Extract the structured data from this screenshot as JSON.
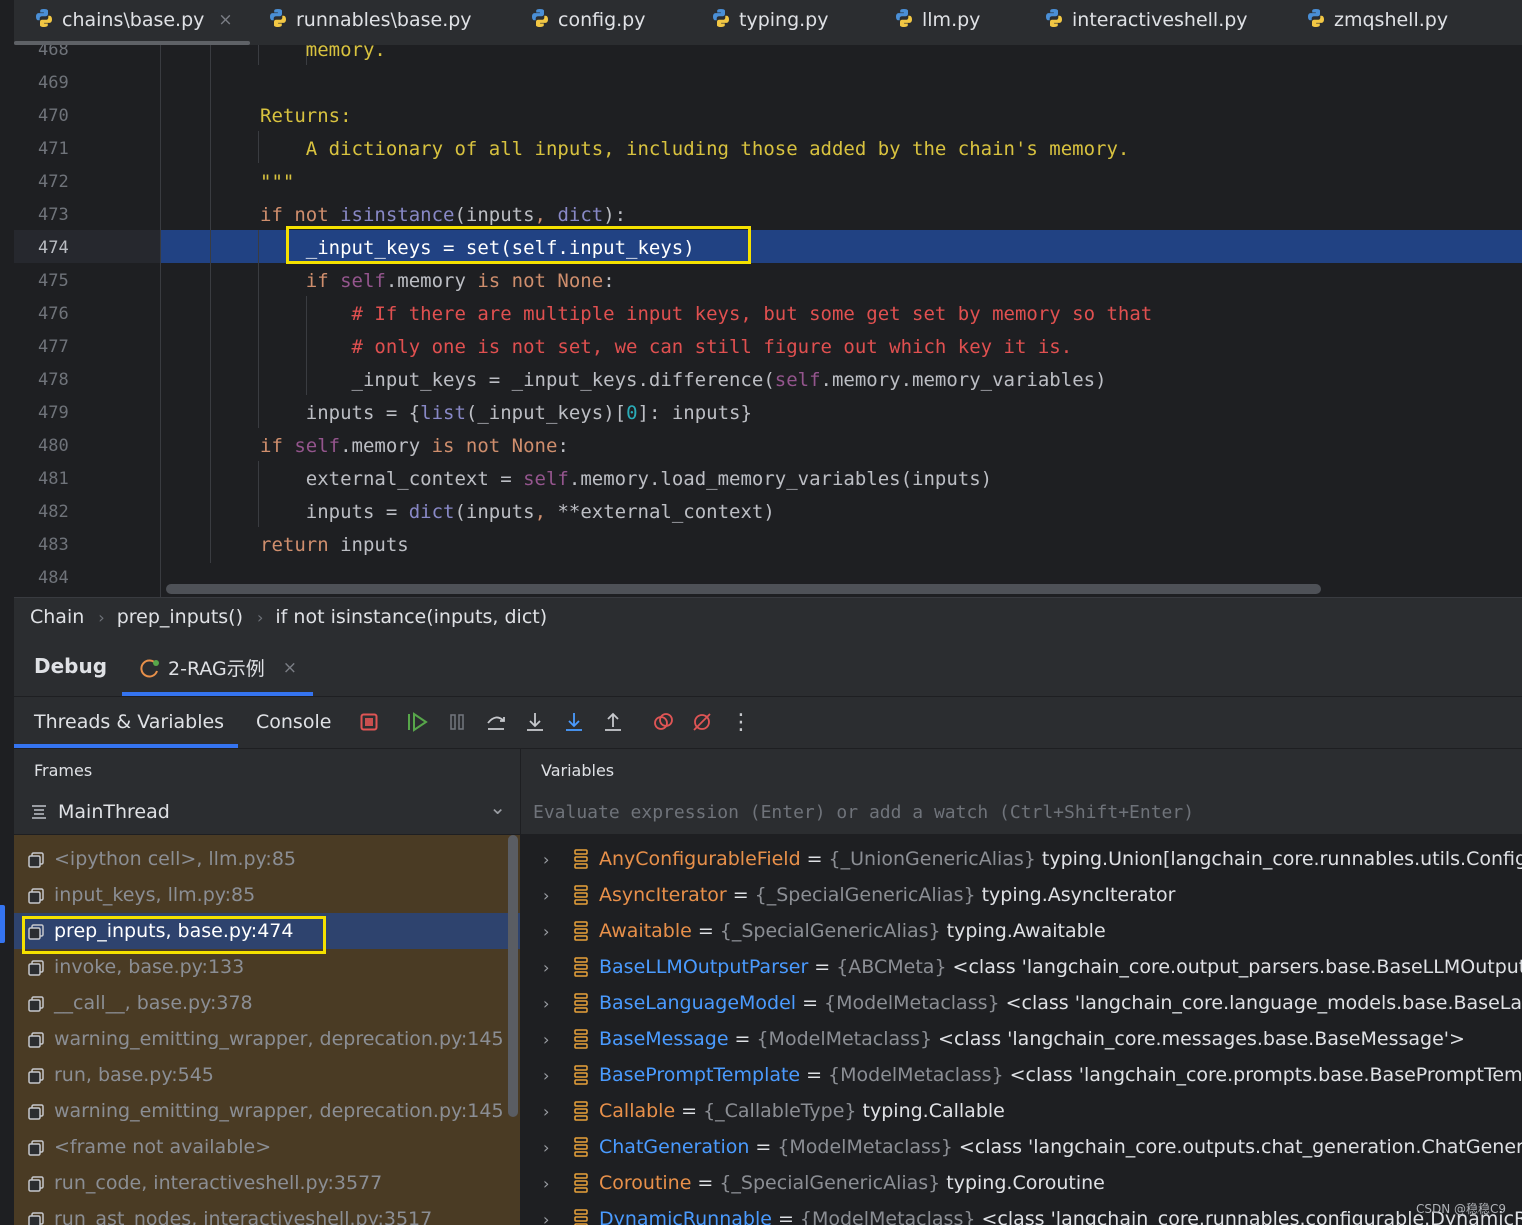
{
  "tabs": [
    {
      "label": "chains\\base.py",
      "active": true
    },
    {
      "label": "runnables\\base.py"
    },
    {
      "label": "config.py"
    },
    {
      "label": "typing.py"
    },
    {
      "label": "llm.py"
    },
    {
      "label": "interactiveshell.py"
    },
    {
      "label": "zmqshell.py"
    }
  ],
  "tab_close_glyph": "×",
  "editor": {
    "line_numbers": [
      "468",
      "469",
      "470",
      "471",
      "472",
      "473",
      "474",
      "475",
      "476",
      "477",
      "478",
      "479",
      "480",
      "481",
      "482",
      "483",
      "484"
    ],
    "current_line": "474",
    "lines": [
      {
        "text": "    memory."
      },
      {
        "text": ""
      },
      {
        "text": "Returns:"
      },
      {
        "text": "    A dictionary of all inputs, including those added by the chain's memory."
      },
      {
        "text": "\"\"\""
      },
      {
        "text": "if not isinstance(inputs, dict):"
      },
      {
        "text": "    _input_keys = set(self.input_keys)"
      },
      {
        "text": "    if self.memory is not None:"
      },
      {
        "text": "        # If there are multiple input keys, but some get set by memory so that"
      },
      {
        "text": "        # only one is not set, we can still figure out which key it is."
      },
      {
        "text": "        _input_keys = _input_keys.difference(self.memory.memory_variables)"
      },
      {
        "text": "    inputs = {list(_input_keys)[0]: inputs}"
      },
      {
        "text": "if self.memory is not None:"
      },
      {
        "text": "    external_context = self.memory.load_memory_variables(inputs)"
      },
      {
        "text": "    inputs = dict(inputs, **external_context)"
      },
      {
        "text": "return inputs"
      },
      {
        "text": ""
      }
    ]
  },
  "breadcrumb": [
    "Chain",
    "prep_inputs()",
    "if not isinstance(inputs, dict)"
  ],
  "breadcrumb_sep": "›",
  "debug": {
    "title": "Debug",
    "run_tab": "2-RAG示例",
    "close_glyph": "×",
    "tabs": [
      "Threads & Variables",
      "Console"
    ],
    "more_glyph": "⋮",
    "frames_header": "Frames",
    "variables_header": "Variables",
    "thread": "MainThread",
    "thread_chevron": "⌄",
    "eval_placeholder": "Evaluate expression (Enter) or add a watch (Ctrl+Shift+Enter)",
    "frames": [
      "<ipython cell>, llm.py:85",
      "input_keys, llm.py:85",
      "prep_inputs, base.py:474",
      "invoke, base.py:133",
      "__call__, base.py:378",
      "warning_emitting_wrapper, deprecation.py:145",
      "run, base.py:545",
      "warning_emitting_wrapper, deprecation.py:145",
      "<frame not available>",
      "run_code, interactiveshell.py:3577",
      "run_ast_nodes, interactiveshell.py:3517"
    ],
    "active_frame": "prep_inputs, base.py:474",
    "variables": [
      {
        "name": "AnyConfigurableField",
        "type": "{_UnionGenericAlias}",
        "value": "typing.Union[langchain_core.runnables.utils.ConfigurableField",
        "color": "orange"
      },
      {
        "name": "AsyncIterator",
        "type": "{_SpecialGenericAlias}",
        "value": "typing.AsyncIterator",
        "color": "orange"
      },
      {
        "name": "Awaitable",
        "type": "{_SpecialGenericAlias}",
        "value": "typing.Awaitable",
        "color": "orange"
      },
      {
        "name": "BaseLLMOutputParser",
        "type": "{ABCMeta}",
        "value": "<class 'langchain_core.output_parsers.base.BaseLLMOutputParser'>",
        "color": "blue"
      },
      {
        "name": "BaseLanguageModel",
        "type": "{ModelMetaclass}",
        "value": "<class 'langchain_core.language_models.base.BaseLanguageModel'>",
        "color": "blue"
      },
      {
        "name": "BaseMessage",
        "type": "{ModelMetaclass}",
        "value": "<class 'langchain_core.messages.base.BaseMessage'>",
        "color": "blue"
      },
      {
        "name": "BasePromptTemplate",
        "type": "{ModelMetaclass}",
        "value": "<class 'langchain_core.prompts.base.BasePromptTemplate'>",
        "color": "blue"
      },
      {
        "name": "Callable",
        "type": "{_CallableType}",
        "value": "typing.Callable",
        "color": "orange"
      },
      {
        "name": "ChatGeneration",
        "type": "{ModelMetaclass}",
        "value": "<class 'langchain_core.outputs.chat_generation.ChatGeneration'>",
        "color": "blue"
      },
      {
        "name": "Coroutine",
        "type": "{_SpecialGenericAlias}",
        "value": "typing.Coroutine",
        "color": "orange"
      },
      {
        "name": "DynamicRunnable",
        "type": "{ModelMetaclass}",
        "value": "<class 'langchain_core.runnables.configurable.DynamicRunnable'>",
        "color": "blue"
      }
    ],
    "var_eq": "=",
    "var_chevron": "›"
  },
  "watermark": "CSDN @稳稳C9",
  "colors": {
    "accent": "#3574f0",
    "highlight_box": "#f5e100",
    "current_line": "#214283",
    "frames_bg": "#4a3b24"
  }
}
